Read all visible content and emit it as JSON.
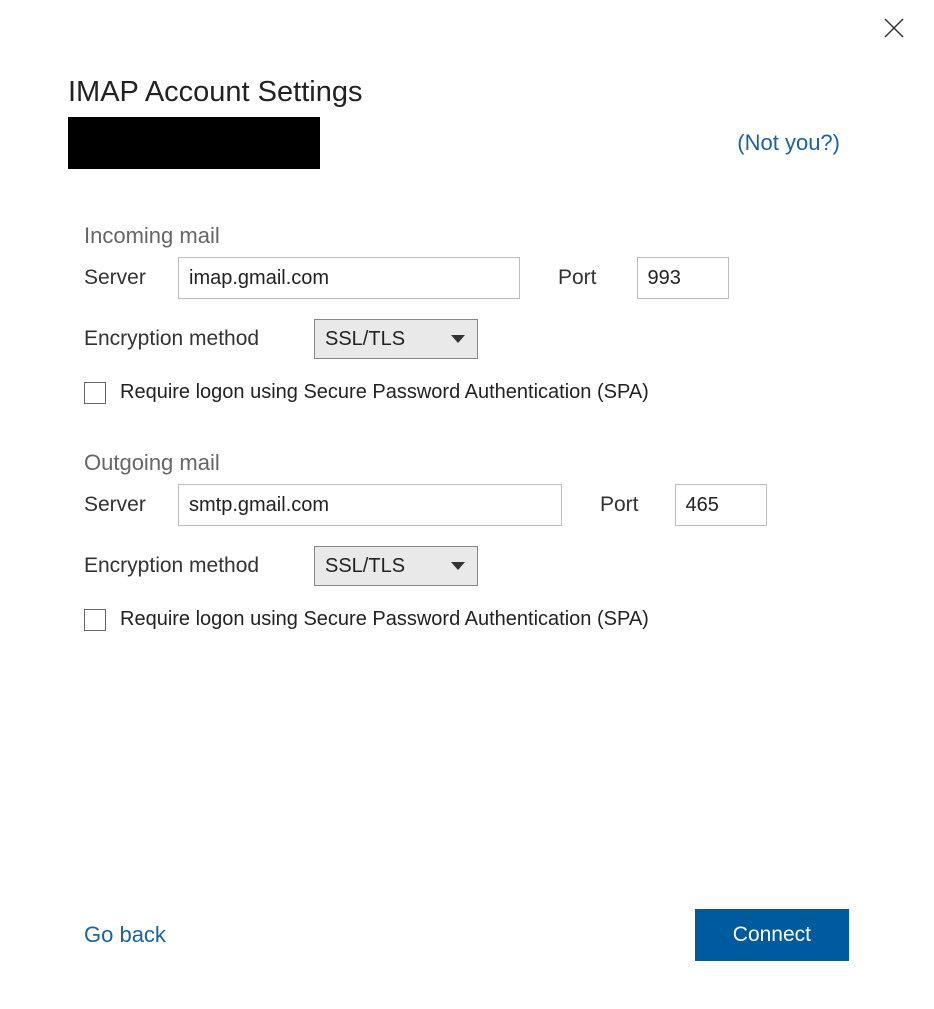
{
  "title": "IMAP Account Settings",
  "not_you": "(Not you?)",
  "incoming": {
    "section": "Incoming mail",
    "server_label": "Server",
    "server_value": "imap.gmail.com",
    "port_label": "Port",
    "port_value": "993",
    "encryption_label": "Encryption method",
    "encryption_value": "SSL/TLS",
    "spa_label": "Require logon using Secure Password Authentication (SPA)"
  },
  "outgoing": {
    "section": "Outgoing mail",
    "server_label": "Server",
    "server_value": "smtp.gmail.com",
    "port_label": "Port",
    "port_value": "465",
    "encryption_label": "Encryption method",
    "encryption_value": "SSL/TLS",
    "spa_label": "Require logon using Secure Password Authentication (SPA)"
  },
  "footer": {
    "go_back": "Go back",
    "connect": "Connect"
  }
}
